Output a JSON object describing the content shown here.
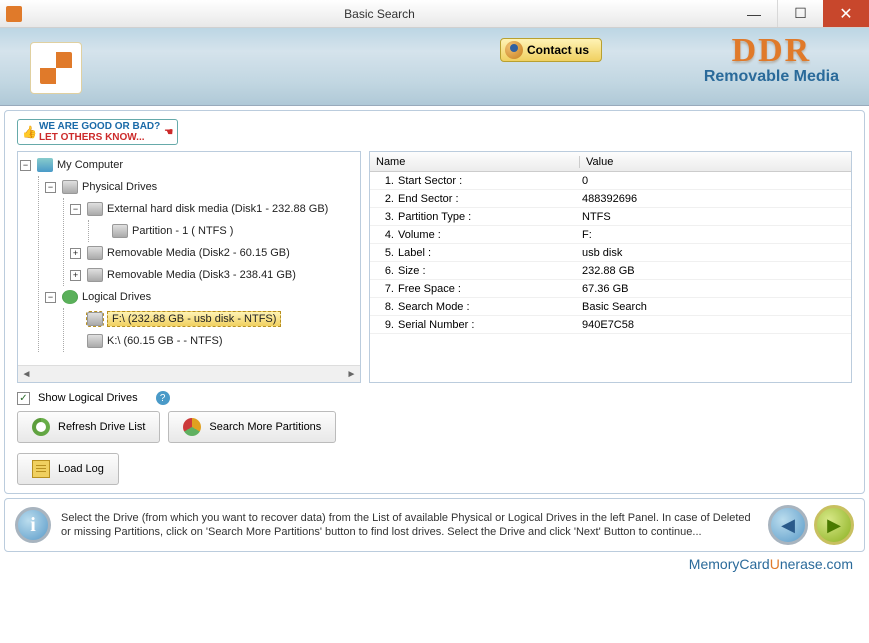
{
  "window": {
    "title": "Basic Search"
  },
  "banner": {
    "contact_label": "Contact us",
    "brand_top": "DDR",
    "brand_sub": "Removable Media"
  },
  "feedback": {
    "line1": "WE ARE GOOD OR BAD?",
    "line2": "LET OTHERS KNOW..."
  },
  "tree": {
    "root": "My Computer",
    "physical": {
      "label": "Physical Drives",
      "items": [
        {
          "label": "External hard disk media (Disk1 - 232.88 GB)",
          "children": [
            {
              "label": "Partition - 1 ( NTFS )"
            }
          ]
        },
        {
          "label": "Removable Media (Disk2 - 60.15 GB)"
        },
        {
          "label": "Removable Media (Disk3 - 238.41 GB)"
        }
      ]
    },
    "logical": {
      "label": "Logical Drives",
      "items": [
        {
          "label": "F:\\ (232.88 GB - usb disk - NTFS)",
          "selected": true
        },
        {
          "label": "K:\\ (60.15 GB -  - NTFS)"
        }
      ]
    }
  },
  "grid": {
    "headers": {
      "name": "Name",
      "value": "Value"
    },
    "rows": [
      {
        "n": "1.",
        "name": "Start Sector :",
        "value": "0"
      },
      {
        "n": "2.",
        "name": "End Sector :",
        "value": "488392696"
      },
      {
        "n": "3.",
        "name": "Partition Type :",
        "value": "NTFS"
      },
      {
        "n": "4.",
        "name": "Volume :",
        "value": "F:"
      },
      {
        "n": "5.",
        "name": "Label :",
        "value": "usb disk"
      },
      {
        "n": "6.",
        "name": "Size :",
        "value": "232.88 GB"
      },
      {
        "n": "7.",
        "name": "Free Space :",
        "value": "67.36 GB"
      },
      {
        "n": "8.",
        "name": "Search Mode :",
        "value": "Basic Search"
      },
      {
        "n": "9.",
        "name": "Serial Number :",
        "value": "940E7C58"
      }
    ]
  },
  "controls": {
    "show_logical_label": "Show Logical Drives",
    "show_logical_checked": true,
    "refresh_label": "Refresh Drive List",
    "search_more_label": "Search More Partitions",
    "load_log_label": "Load Log"
  },
  "footer": {
    "text": "Select the Drive (from which you want to recover data) from the List of available Physical or Logical Drives in the left Panel. In case of Deleted or missing Partitions, click on 'Search More Partitions' button to find lost drives. Select the Drive and click 'Next' Button to continue..."
  },
  "site": {
    "m": "M",
    "emory": "emory",
    "c": "C",
    "ard": "ard",
    "u": "U",
    "nerase": "nerase",
    "dom": ".com"
  }
}
